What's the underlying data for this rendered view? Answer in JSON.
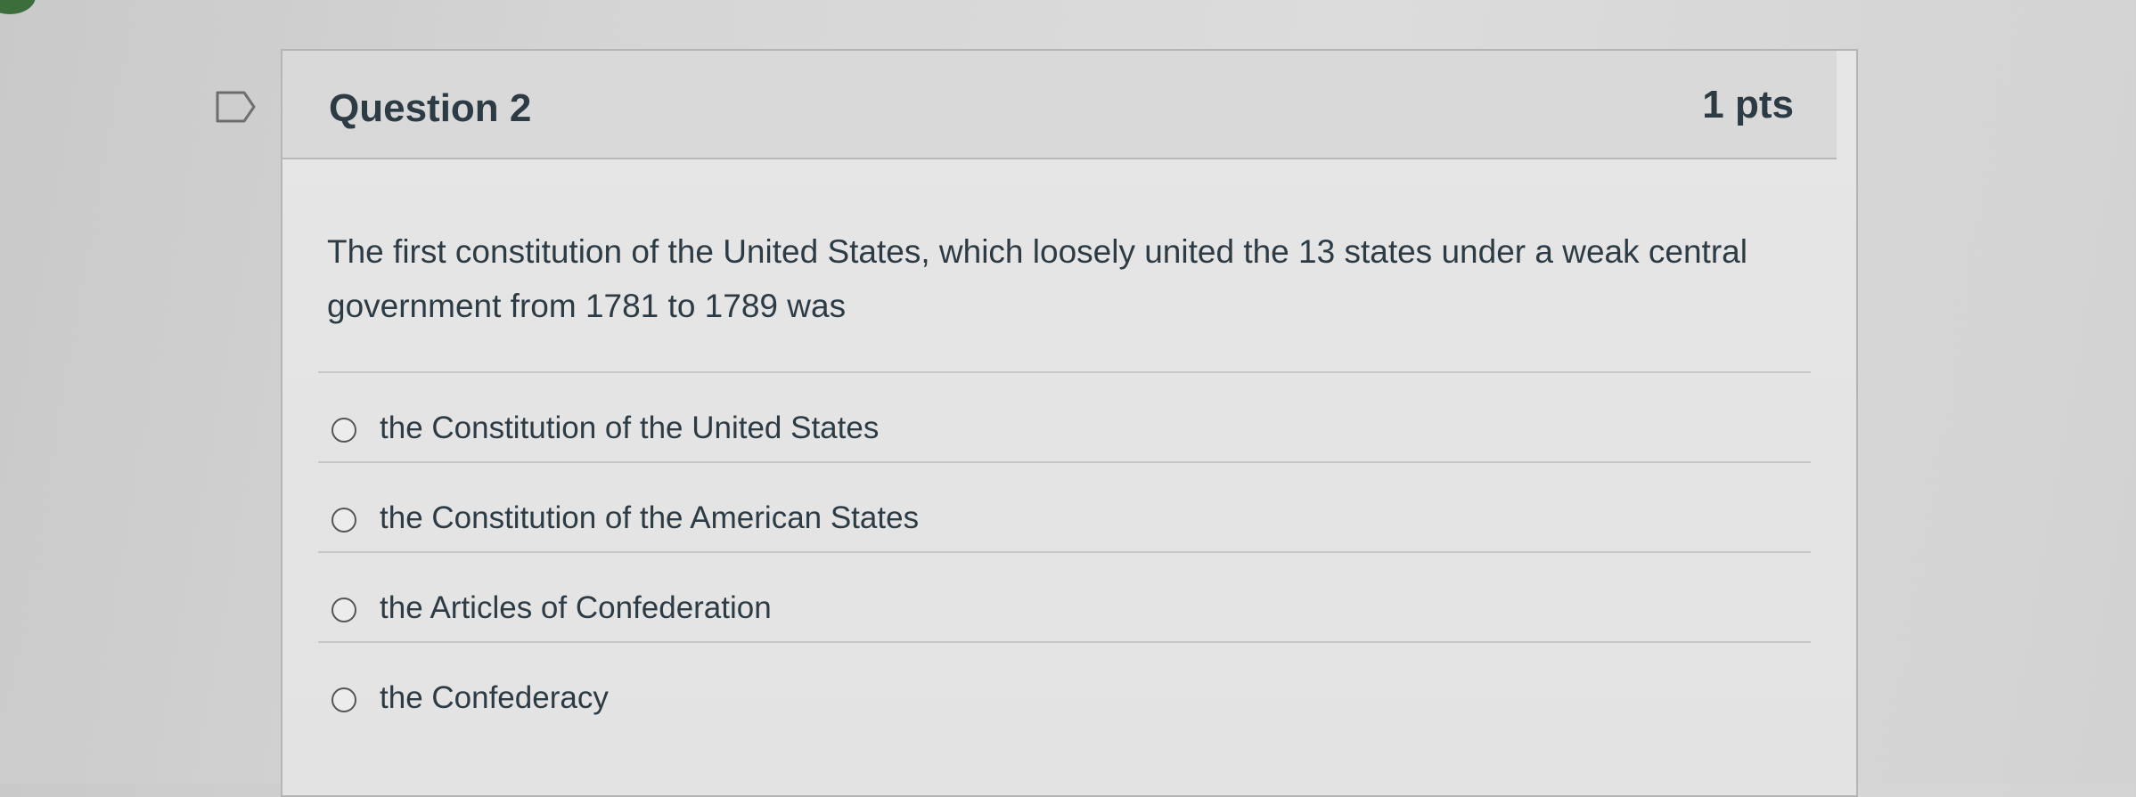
{
  "question": {
    "title": "Question 2",
    "points": "1 pts",
    "text": "The first constitution of the United States, which loosely united the 13 states under a weak central government from 1781 to 1789 was",
    "flag_icon": "flag-question-icon"
  },
  "answers": [
    {
      "label": "the Constitution of the United States",
      "selected": false
    },
    {
      "label": "the Constitution of the American States",
      "selected": false
    },
    {
      "label": "the Articles of Confederation",
      "selected": false
    },
    {
      "label": "the Confederacy",
      "selected": false
    }
  ],
  "colors": {
    "text": "#2d3b45",
    "header_bg": "#d9d9d9",
    "card_bg": "#e6e6e6",
    "border": "#b5b5b5"
  }
}
